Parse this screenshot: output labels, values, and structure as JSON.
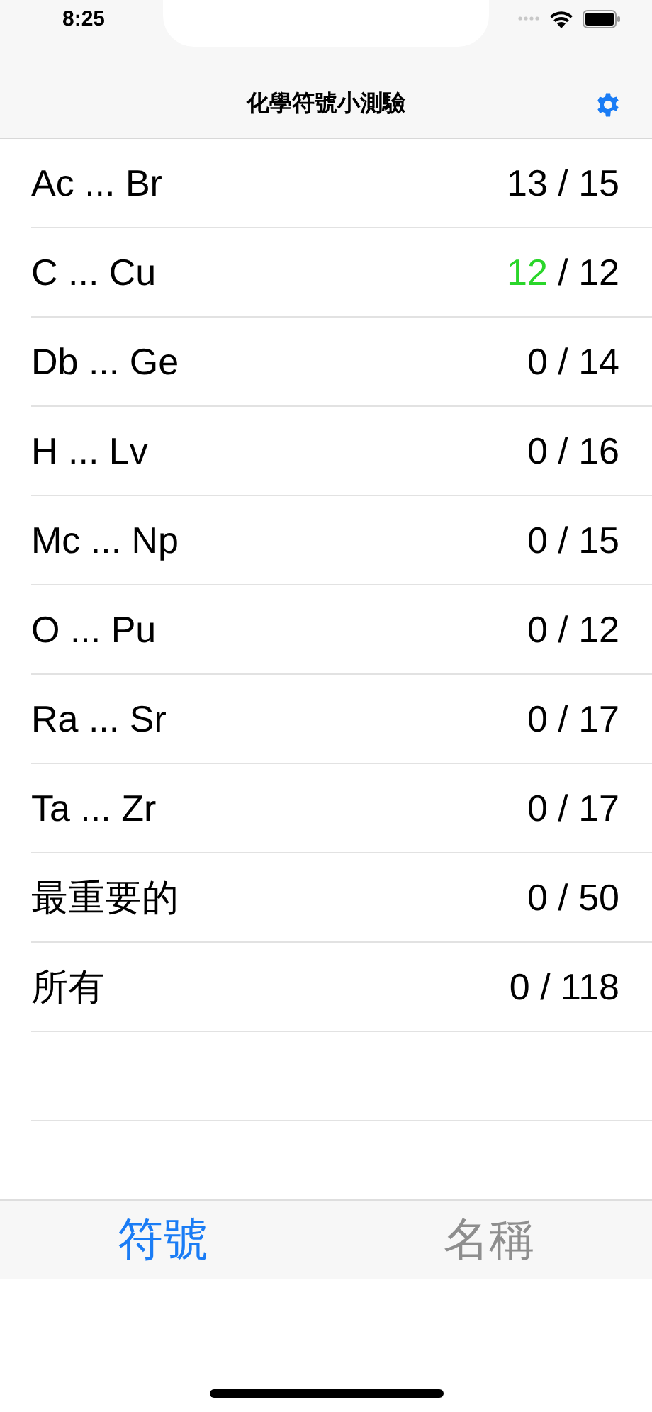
{
  "status_bar": {
    "time": "8:25"
  },
  "nav_bar": {
    "title": "化學符號小測驗"
  },
  "rows": [
    {
      "label": "Ac ... Br",
      "correct": "13",
      "out_of": "/ 15",
      "complete": false
    },
    {
      "label": "C ... Cu",
      "correct": "12",
      "out_of": "/ 12",
      "complete": true
    },
    {
      "label": "Db ... Ge",
      "correct": "0",
      "out_of": "/ 14",
      "complete": false
    },
    {
      "label": "H ... Lv",
      "correct": "0",
      "out_of": "/ 16",
      "complete": false
    },
    {
      "label": "Mc ... Np",
      "correct": "0",
      "out_of": "/ 15",
      "complete": false
    },
    {
      "label": "O ... Pu",
      "correct": "0",
      "out_of": "/ 12",
      "complete": false
    },
    {
      "label": "Ra ... Sr",
      "correct": "0",
      "out_of": "/ 17",
      "complete": false
    },
    {
      "label": "Ta ... Zr",
      "correct": "0",
      "out_of": "/ 17",
      "complete": false
    },
    {
      "label": "最重要的",
      "correct": "0",
      "out_of": "/ 50",
      "complete": false
    },
    {
      "label": "所有",
      "correct": "0",
      "out_of": "/ 118",
      "complete": false
    }
  ],
  "tabs": [
    {
      "label": "符號",
      "selected": true
    },
    {
      "label": "名稱",
      "selected": false
    }
  ]
}
